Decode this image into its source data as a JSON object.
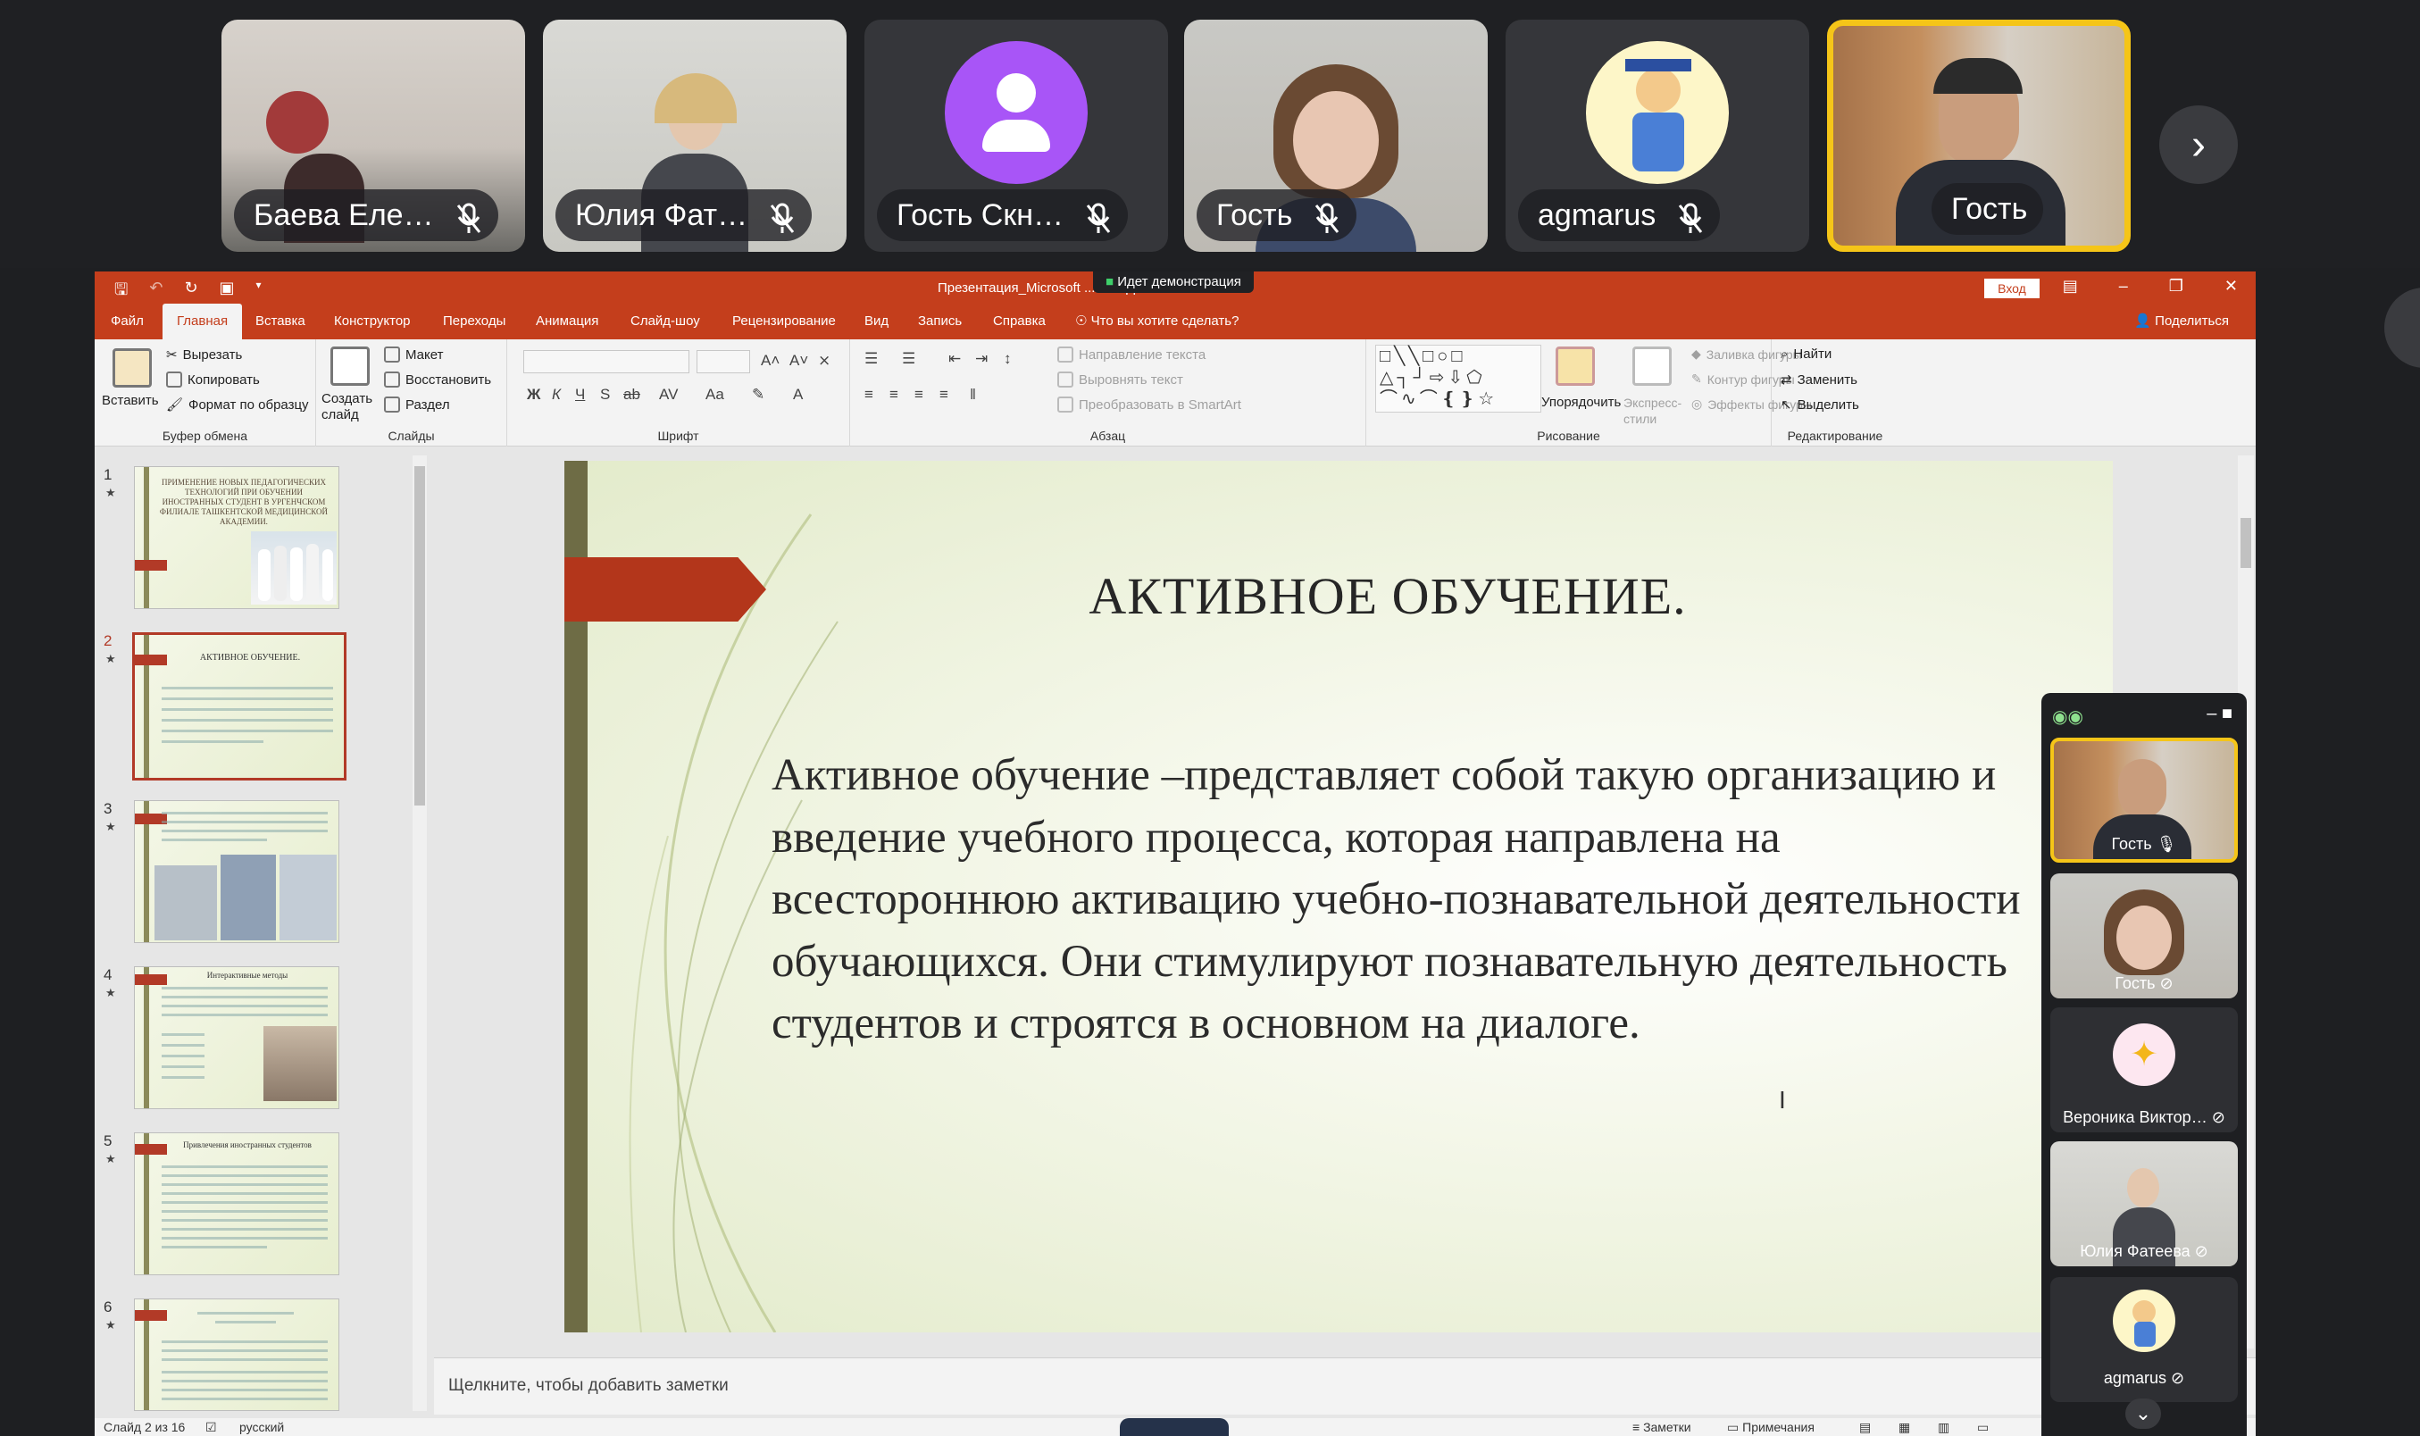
{
  "participants": [
    {
      "name": "Баева Еле…"
    },
    {
      "name": "Юлия Фат…"
    },
    {
      "name": "Гость Скн…"
    },
    {
      "name": "Гость"
    },
    {
      "name": "agmarus"
    },
    {
      "name": "Гость"
    }
  ],
  "titlebar": {
    "title": "Презентация_Microsoft ... или.pptx  -  PowerPoint",
    "demo_banner": "Идет демонстрация",
    "login": "Вход"
  },
  "tabs": [
    "Файл",
    "Главная",
    "Вставка",
    "Конструктор",
    "Переходы",
    "Анимация",
    "Слайд-шоу",
    "Рецензирование",
    "Вид",
    "Запись",
    "Справка"
  ],
  "tell_me": "Что вы хотите сделать?",
  "share": "Поделиться",
  "ribbon": {
    "clipboard": {
      "paste": "Вставить",
      "cut": "Вырезать",
      "copy": "Копировать",
      "format_painter": "Формат по образцу",
      "label": "Буфер обмена"
    },
    "slides": {
      "new_slide": "Создать слайд",
      "layout": "Макет",
      "reset": "Восстановить",
      "section": "Раздел",
      "label": "Слайды"
    },
    "font": {
      "label": "Шрифт"
    },
    "paragraph": {
      "text_direction": "Направление текста",
      "align_text": "Выровнять текст",
      "smartart": "Преобразовать в SmartArt",
      "label": "Абзац"
    },
    "drawing": {
      "arrange": "Упорядочить",
      "quick_styles": "Экспресс-стили",
      "shape_fill": "Заливка фигуры",
      "shape_outline": "Контур фигуры",
      "shape_effects": "Эффекты фигуры",
      "label": "Рисование"
    },
    "editing": {
      "find": "Найти",
      "replace": "Заменить",
      "select": "Выделить",
      "label": "Редактирование"
    }
  },
  "thumbs": [
    {
      "num": "1",
      "caption": "ПРИМЕНЕНИЕ НОВЫХ ПЕДАГОГИЧЕСКИХ ТЕХНОЛОГИЙ ПРИ ОБУЧЕНИИ ИНОСТРАННЫХ СТУДЕНТ В УРГЕНЧСКОМ ФИЛИАЛЕ ТАШКЕНТСКОЙ МЕДИЦИНСКОЙ АКАДЕМИИ."
    },
    {
      "num": "2",
      "caption": "АКТИВНОЕ ОБУЧЕНИЕ."
    },
    {
      "num": "3",
      "caption": ""
    },
    {
      "num": "4",
      "caption": "Интерактивные методы"
    },
    {
      "num": "5",
      "caption": "Привлечения иностранных студентов"
    },
    {
      "num": "6",
      "caption": ""
    }
  ],
  "slide": {
    "title": "АКТИВНОЕ ОБУЧЕНИЕ.",
    "body": "Активное обучение –представляет собой такую организацию и введение учебного процесса, которая направлена на всестороннюю активацию учебно-познавательной деятельности обучающихся. Они стимулируют познавательную деятельность студентов и строятся в основном на диалоге."
  },
  "notes_placeholder": "Щелкните, чтобы добавить заметки",
  "status": {
    "slide": "Слайд 2 из 16",
    "language": "русский",
    "notes": "Заметки",
    "comments": "Примечания"
  },
  "side_panel": [
    {
      "name": "Гость"
    },
    {
      "name": "Гость"
    },
    {
      "name": "Вероника Виктор…"
    },
    {
      "name": "Юлия Фатеева"
    },
    {
      "name": "agmarus"
    }
  ],
  "colors": {
    "ppt_accent": "#c43e1c",
    "active_speaker": "#f5c518",
    "avatar_purple": "#a855f7"
  }
}
